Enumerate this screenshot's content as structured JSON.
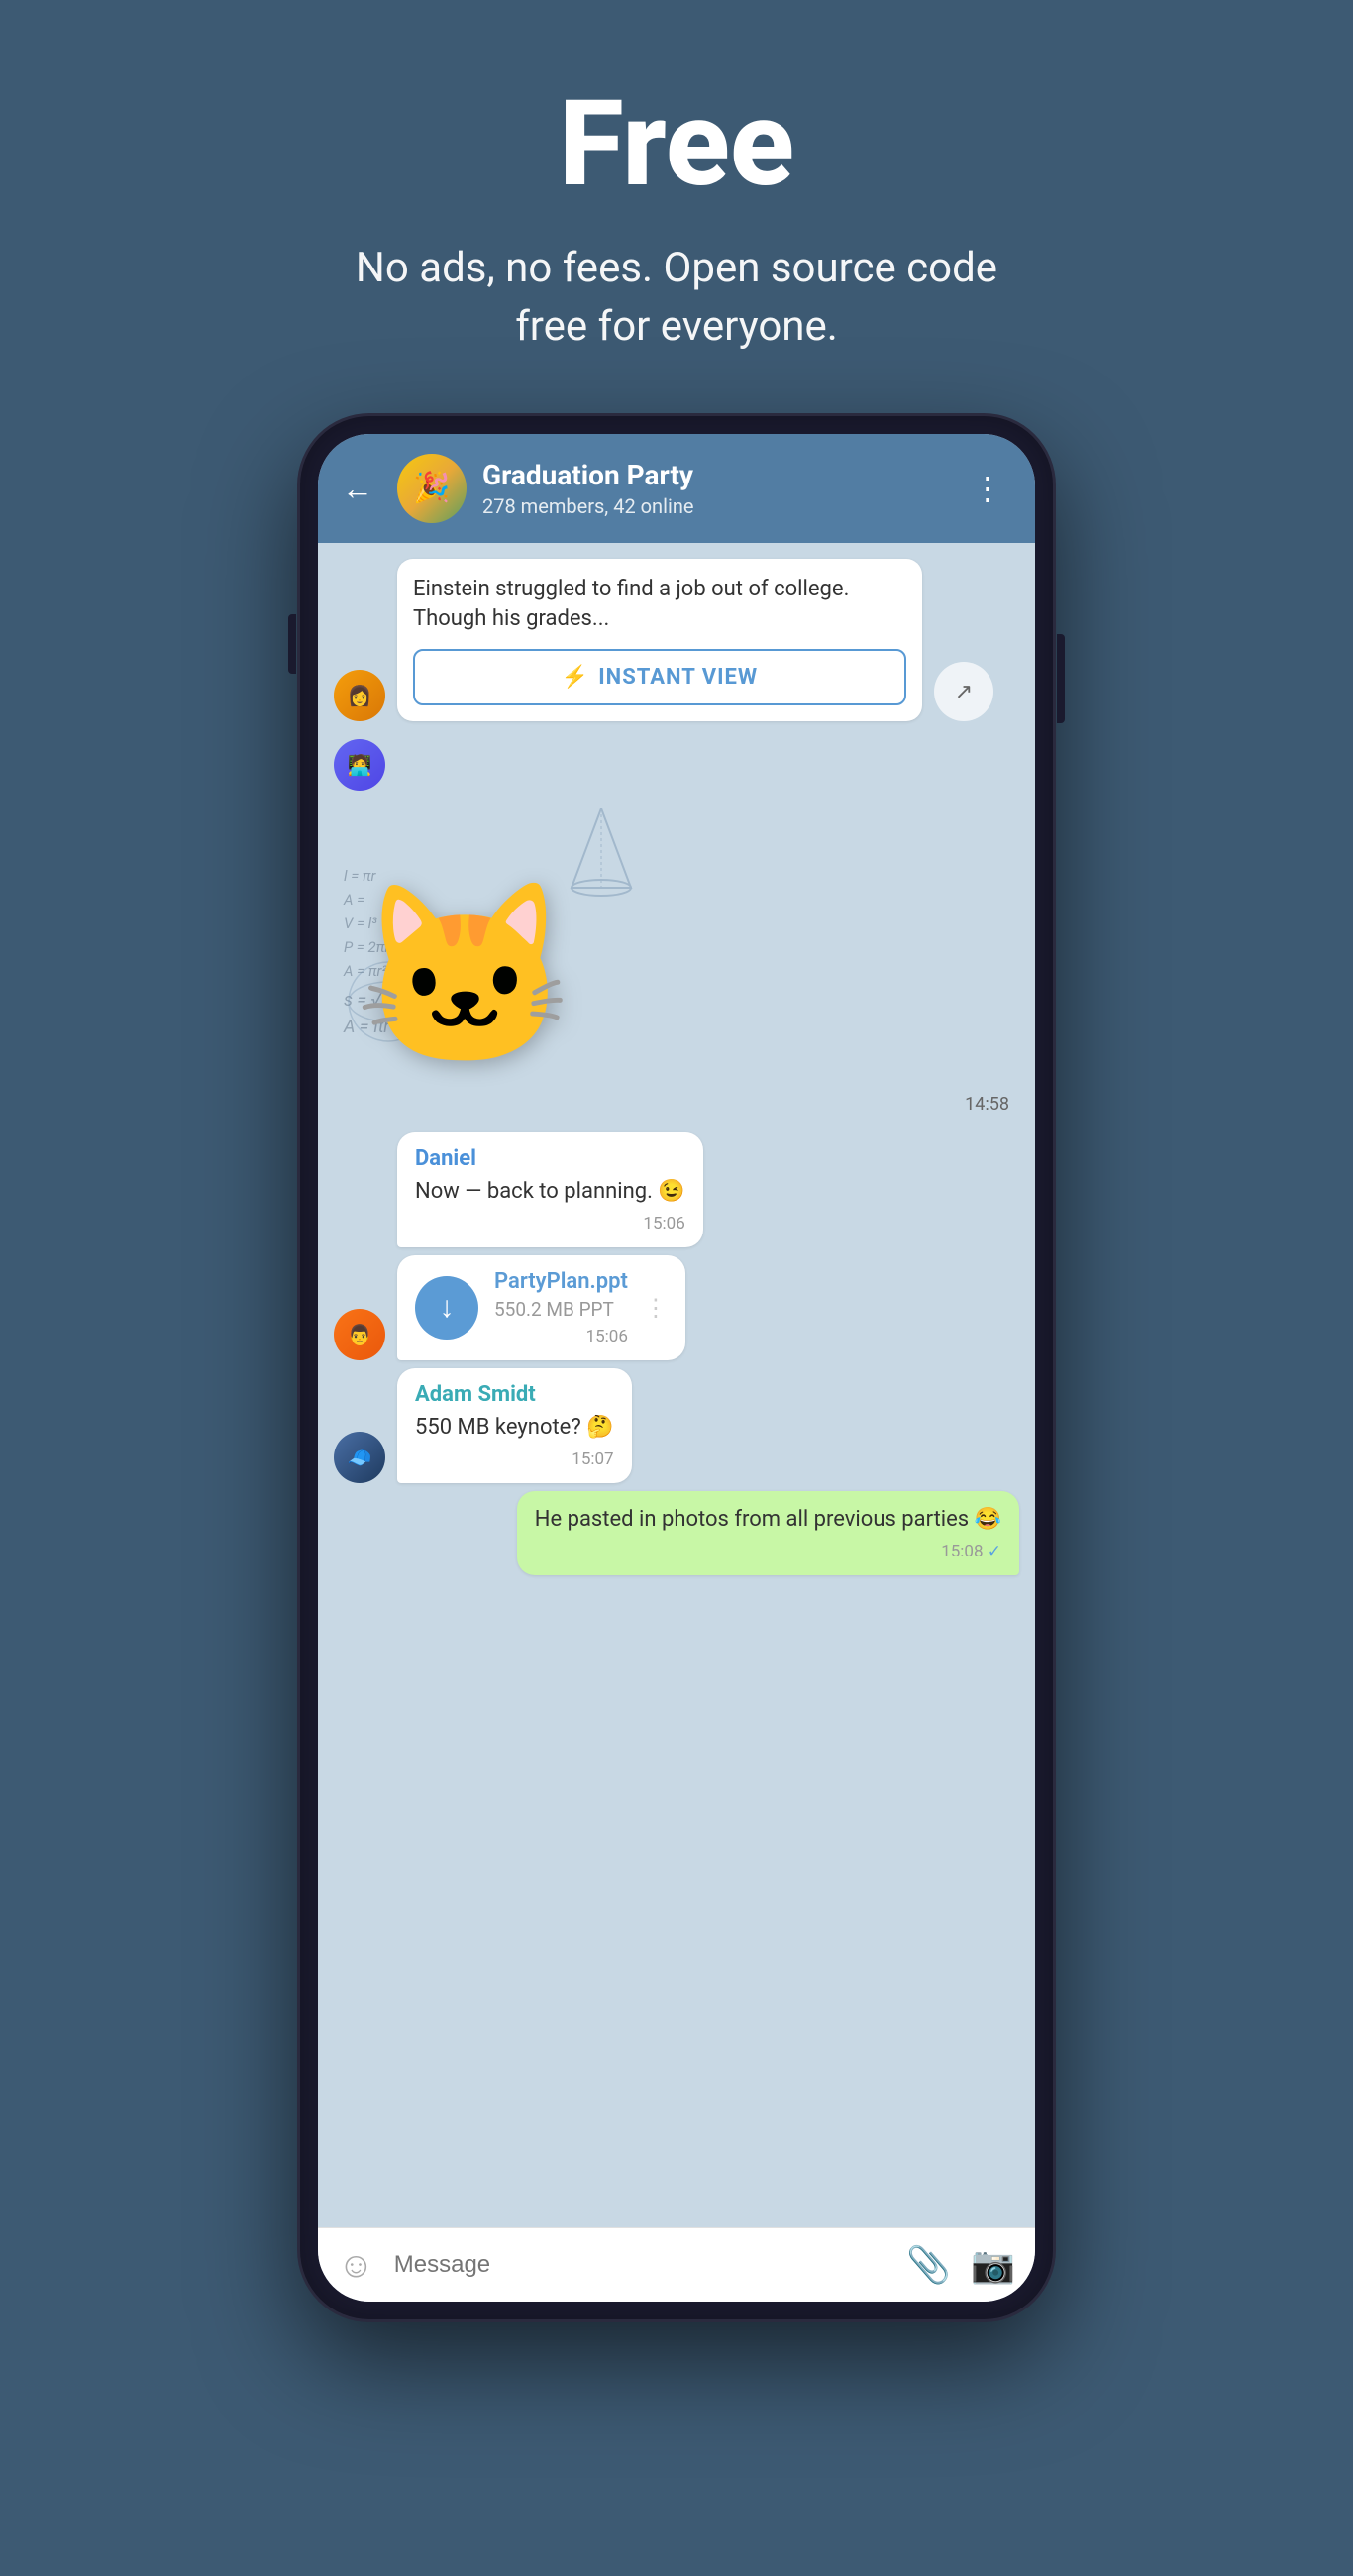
{
  "hero": {
    "title": "Free",
    "subtitle": "No ads, no fees. Open source code free for everyone."
  },
  "chat": {
    "back_label": "←",
    "group_name": "Graduation Party",
    "group_status": "278 members, 42 online",
    "more_icon": "⋮",
    "messages": [
      {
        "type": "link",
        "text": "Einstein struggled to find a job out of college. Though his grades...",
        "instant_view_label": "INSTANT VIEW",
        "time": ""
      },
      {
        "type": "sticker",
        "time": "14:58"
      },
      {
        "type": "text",
        "sender": "Daniel",
        "sender_color": "blue",
        "text": "Now — back to planning. 😉",
        "time": "15:06"
      },
      {
        "type": "file",
        "file_name": "PartyPlan.ppt",
        "file_size": "550.2 MB PPT",
        "time": "15:06"
      },
      {
        "type": "text",
        "sender": "Adam Smidt",
        "sender_color": "teal",
        "text": "550 MB keynote? 🤔",
        "time": "15:07"
      },
      {
        "type": "own",
        "text": "He pasted in photos from all previous parties 😂",
        "time": "15:08",
        "check": true
      }
    ],
    "input_placeholder": "Message",
    "emoji_icon": "☺",
    "attach_icon": "📎",
    "camera_icon": "📷"
  }
}
